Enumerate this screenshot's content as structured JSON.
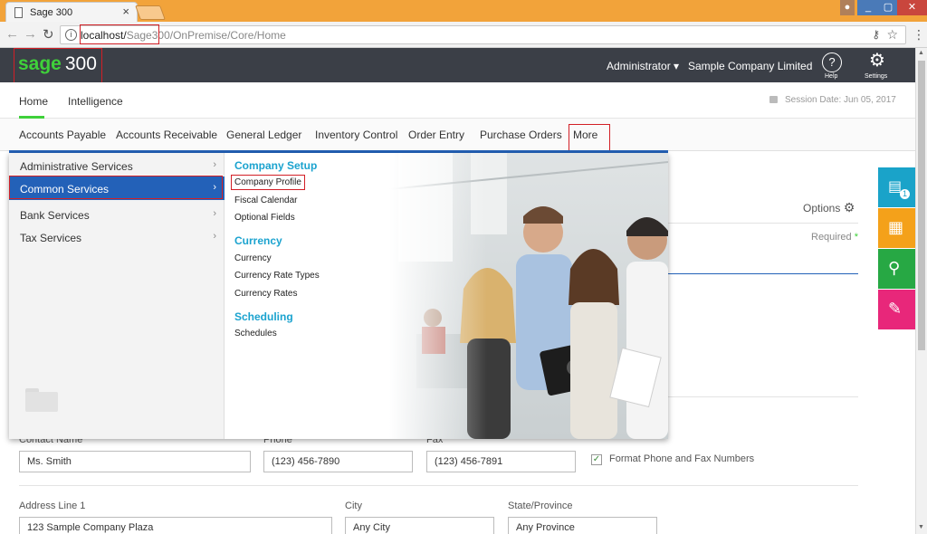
{
  "browser": {
    "tab_title": "Sage 300",
    "url_host": "localhost/",
    "url_path": "Sage300",
    "url_rest": "/OnPremise/Core/Home"
  },
  "header": {
    "logo_sage": "sage",
    "logo_num": "300",
    "user": "Administrator ▾",
    "company": "Sample Company Limited",
    "help_label": "Help",
    "settings_label": "Settings"
  },
  "home_tabs": {
    "home": "Home",
    "intelligence": "Intelligence"
  },
  "session": "Session Date:  Jun 05, 2017",
  "modules": [
    "Accounts Payable",
    "Accounts Receivable",
    "General Ledger",
    "Inventory Control",
    "Order Entry",
    "Purchase Orders",
    "More"
  ],
  "mega_menu": {
    "left": [
      "Administrative Services",
      "Common Services",
      "Bank Services",
      "Tax Services"
    ],
    "sections": [
      {
        "title": "Company Setup",
        "links": [
          "Company Profile",
          "Fiscal Calendar",
          "Optional Fields"
        ]
      },
      {
        "title": "Currency",
        "links": [
          "Currency",
          "Currency Rate Types",
          "Currency Rates"
        ]
      },
      {
        "title": "Scheduling",
        "links": [
          "Schedules"
        ]
      }
    ]
  },
  "page": {
    "options": "Options",
    "required": "Required",
    "contact_label": "Contact Name",
    "contact_value": "Ms. Smith",
    "phone_label": "Phone",
    "phone_value": "(123) 456-7890",
    "fax_label": "Fax",
    "fax_value": "(123) 456-7891",
    "format_label": "Format Phone and Fax Numbers",
    "addr_label": "Address Line 1",
    "addr_value": "123 Sample Company Plaza",
    "city_label": "City",
    "city_value": "Any City",
    "state_label": "State/Province",
    "state_value": "Any Province"
  },
  "tool_badge": "1",
  "colors": {
    "header_bg": "#3b3f47",
    "sage_green": "#3fd13a",
    "menu_blue": "#2361b8",
    "section_cyan": "#1ba3cf",
    "tool_teal": "#1aa3c9",
    "tool_orange": "#f4a11a",
    "tool_green": "#27a844",
    "tool_pink": "#e8277a"
  }
}
